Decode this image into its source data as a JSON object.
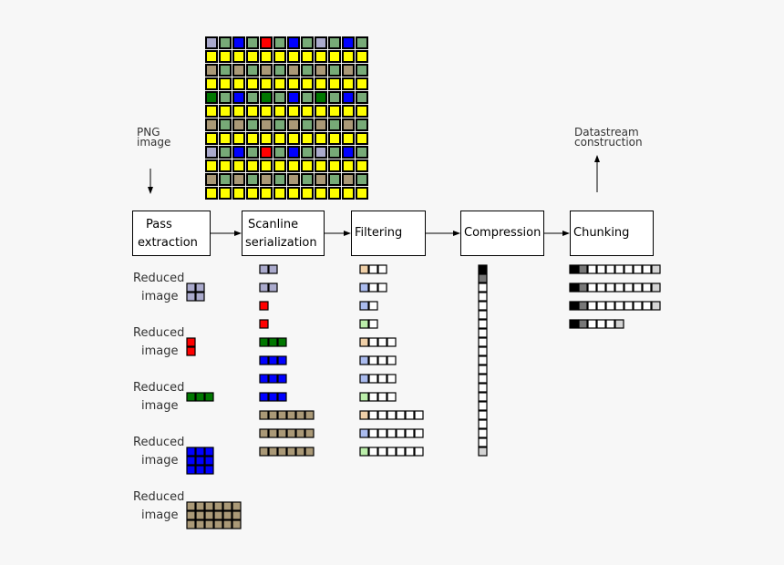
{
  "labels": {
    "input": "PNG\nimage",
    "output": "Datastream\nconstruction",
    "reduced": "Reduced",
    "reduced2": "image"
  },
  "stages": [
    {
      "line1": "Pass",
      "line2": "extraction"
    },
    {
      "line1": "Scanline",
      "line2": "serialization"
    },
    {
      "line1": "Filtering",
      "line2": ""
    },
    {
      "line1": "Compression",
      "line2": ""
    },
    {
      "line1": "Chunking",
      "line2": ""
    }
  ],
  "colors": {
    "pass1": "#aaaacc",
    "pass2": "#ff0000",
    "pass3": "#007700",
    "pass4": "#0000ff",
    "pass5": "#aa9977",
    "pass6": "#77aa77",
    "pass7": "#ffff00",
    "filter_a": "#f0d0a8",
    "filter_b": "#aabbee",
    "filter_c": "#bbeeaa",
    "black": "#000000",
    "gray": "#777777",
    "white": "#ffffff",
    "light": "#d4d4d4"
  },
  "image_rows": [
    [
      1,
      6,
      4,
      6,
      2,
      6,
      4,
      6,
      1,
      6,
      4,
      6
    ],
    [
      7,
      7,
      7,
      7,
      7,
      7,
      7,
      7,
      7,
      7,
      7,
      7
    ],
    [
      5,
      6,
      5,
      6,
      5,
      6,
      5,
      6,
      5,
      6,
      5,
      6
    ],
    [
      7,
      7,
      7,
      7,
      7,
      7,
      7,
      7,
      7,
      7,
      7,
      7
    ],
    [
      3,
      6,
      4,
      6,
      3,
      6,
      4,
      6,
      3,
      6,
      4,
      6
    ],
    [
      7,
      7,
      7,
      7,
      7,
      7,
      7,
      7,
      7,
      7,
      7,
      7
    ],
    [
      5,
      6,
      5,
      6,
      5,
      6,
      5,
      6,
      5,
      6,
      5,
      6
    ],
    [
      7,
      7,
      7,
      7,
      7,
      7,
      7,
      7,
      7,
      7,
      7,
      7
    ],
    [
      1,
      6,
      4,
      6,
      2,
      6,
      4,
      6,
      1,
      6,
      4,
      6
    ],
    [
      7,
      7,
      7,
      7,
      7,
      7,
      7,
      7,
      7,
      7,
      7,
      7
    ],
    [
      5,
      6,
      5,
      6,
      5,
      6,
      5,
      6,
      5,
      6,
      5,
      6
    ],
    [
      7,
      7,
      7,
      7,
      7,
      7,
      7,
      7,
      7,
      7,
      7,
      7
    ]
  ],
  "reduced_images": [
    {
      "pass": 1,
      "cols": 2,
      "rows": 2
    },
    {
      "pass": 2,
      "cols": 1,
      "rows": 2
    },
    {
      "pass": 3,
      "cols": 3,
      "rows": 1
    },
    {
      "pass": 4,
      "cols": 3,
      "rows": 3
    },
    {
      "pass": 5,
      "cols": 6,
      "rows": 3
    }
  ],
  "scanlines": [
    {
      "pass": 1,
      "len": 2,
      "filter": "filter_a"
    },
    {
      "pass": 1,
      "len": 2,
      "filter": "filter_b"
    },
    {
      "pass": 2,
      "len": 1,
      "filter": "filter_b"
    },
    {
      "pass": 2,
      "len": 1,
      "filter": "filter_c"
    },
    {
      "pass": 3,
      "len": 3,
      "filter": "filter_a"
    },
    {
      "pass": 4,
      "len": 3,
      "filter": "filter_b"
    },
    {
      "pass": 4,
      "len": 3,
      "filter": "filter_b"
    },
    {
      "pass": 4,
      "len": 3,
      "filter": "filter_c"
    },
    {
      "pass": 5,
      "len": 6,
      "filter": "filter_a"
    },
    {
      "pass": 5,
      "len": 6,
      "filter": "filter_b"
    },
    {
      "pass": 5,
      "len": 6,
      "filter": "filter_c"
    }
  ],
  "compressed_stream": [
    "black",
    "gray",
    "white",
    "white",
    "white",
    "white",
    "white",
    "white",
    "white",
    "white",
    "white",
    "white",
    "white",
    "white",
    "white",
    "white",
    "white",
    "white",
    "white",
    "white",
    "light"
  ],
  "chunks": [
    [
      "black",
      "gray",
      "white",
      "white",
      "white",
      "white",
      "white",
      "white",
      "white",
      "light"
    ],
    [
      "black",
      "gray",
      "white",
      "white",
      "white",
      "white",
      "white",
      "white",
      "white",
      "light"
    ],
    [
      "black",
      "gray",
      "white",
      "white",
      "white",
      "white",
      "white",
      "white",
      "white",
      "light"
    ],
    [
      "black",
      "gray",
      "white",
      "white",
      "white",
      "light"
    ]
  ]
}
